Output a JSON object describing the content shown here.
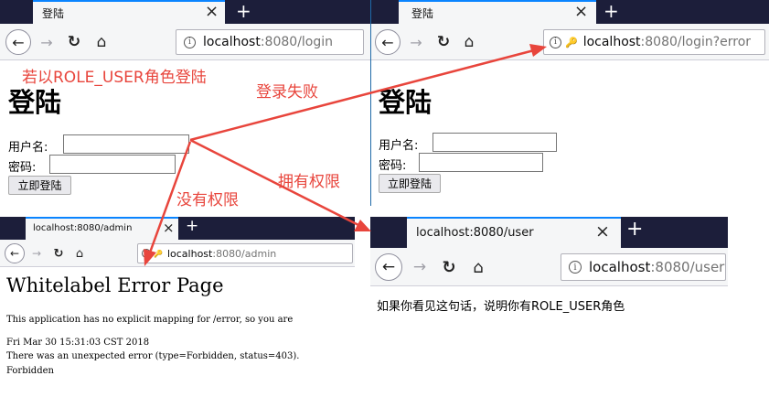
{
  "login_window": {
    "tab_title": "登陆",
    "url_host": "localhost",
    "url_rest": ":8080/login",
    "heading": "登陆",
    "username_label": "用户名:",
    "password_label": "密码:",
    "submit_label": "立即登陆"
  },
  "error_login_window": {
    "tab_title": "登陆",
    "url_host": "localhost",
    "url_rest": ":8080/login?error",
    "heading": "登陆",
    "username_label": "用户名:",
    "password_label": "密码:",
    "submit_label": "立即登陆"
  },
  "admin_window": {
    "tab_title": "localhost:8080/admin",
    "url_host": "localhost",
    "url_rest": ":8080/admin",
    "error_title": "Whitelabel Error Page",
    "line1": "This application has no explicit mapping for /error, so you are",
    "line2": "Fri Mar 30 15:31:03 CST 2018",
    "line3": "There was an unexpected error (type=Forbidden, status=403).",
    "line4": "Forbidden"
  },
  "user_window": {
    "tab_title": "localhost:8080/user",
    "url_host": "localhost",
    "url_rest": ":8080/user",
    "message": "如果你看见这句话，说明你有ROLE_USER角色"
  },
  "annotations": {
    "role_note": "若以ROLE_USER角色登陆",
    "login_failed": "登录失败",
    "no_permission": "没有权限",
    "has_permission": "拥有权限"
  },
  "icons": {
    "close": "×",
    "new_tab": "+",
    "back": "←",
    "forward": "→",
    "reload": "↻",
    "home": "⌂",
    "info": "i",
    "key": "🔑"
  },
  "colors": {
    "annotation": "#e8453c",
    "tab_strip": "#1c1e3a",
    "active_tab_accent": "#0a84ff"
  }
}
